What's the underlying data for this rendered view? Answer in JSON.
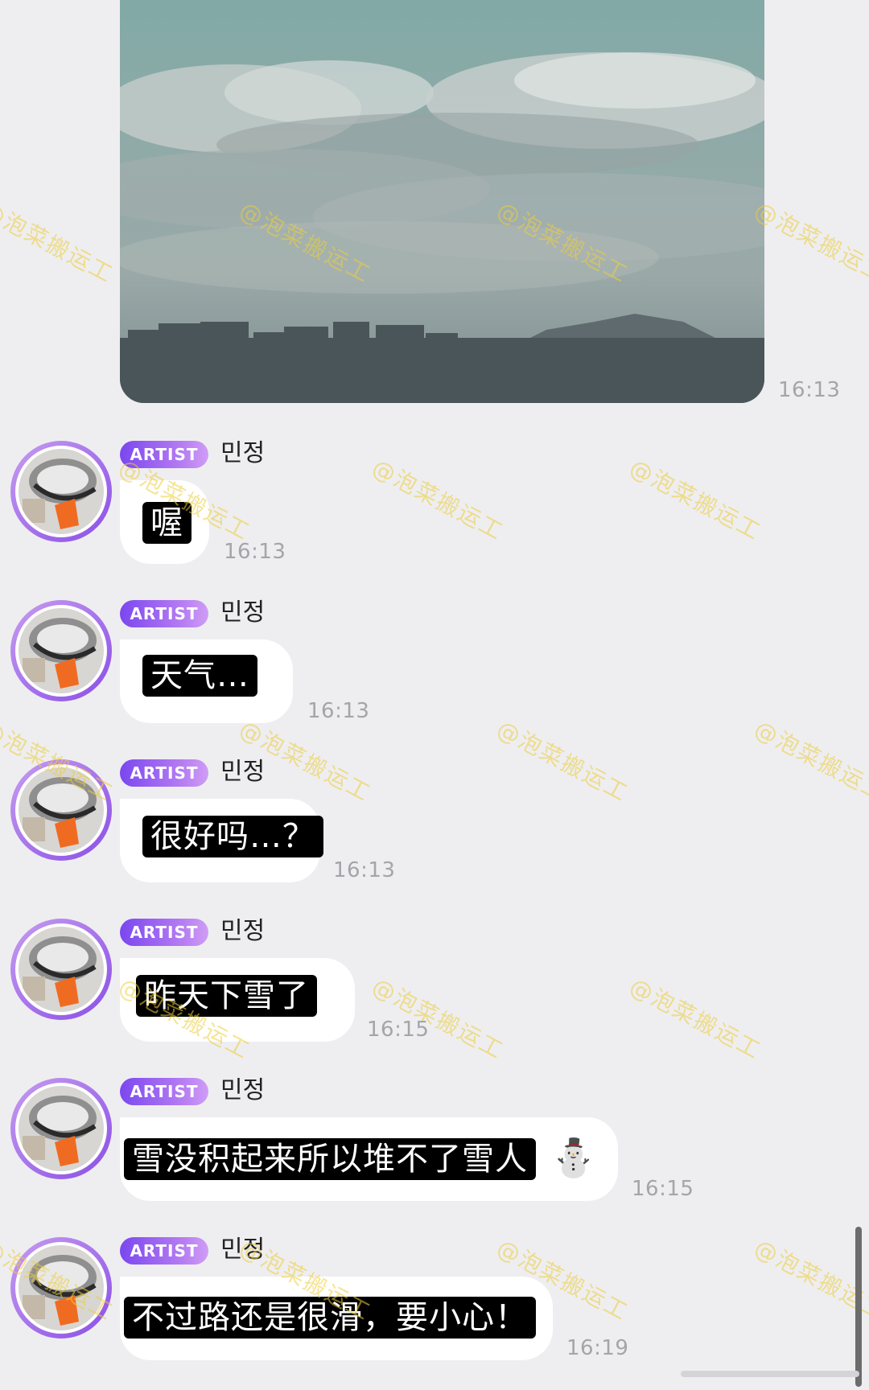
{
  "image_message": {
    "time": "16:13"
  },
  "messages": [
    {
      "badge": "ARTIST",
      "sender": "민정",
      "text": "喔",
      "time": "16:13"
    },
    {
      "badge": "ARTIST",
      "sender": "민정",
      "text": "天气…",
      "time": "16:13"
    },
    {
      "badge": "ARTIST",
      "sender": "민정",
      "text": "很好吗…？",
      "time": "16:13"
    },
    {
      "badge": "ARTIST",
      "sender": "민정",
      "text": "昨天下雪了",
      "time": "16:15"
    },
    {
      "badge": "ARTIST",
      "sender": "민정",
      "text": "雪没积起来所以堆不了雪人",
      "emoji": "⛄",
      "time": "16:15"
    },
    {
      "badge": "ARTIST",
      "sender": "민정",
      "text": "不过路还是很滑，要小心！",
      "time": "16:19"
    }
  ],
  "watermark": "@泡菜搬运工",
  "colors": {
    "background": "#eeeef1",
    "badge_start": "#7b47ef",
    "badge_end": "#cf9df5",
    "avatar_ring": "#8a4fe6",
    "bubble": "#ffffff",
    "caption_bg": "#000000",
    "timestamp": "#a4a4aa"
  }
}
